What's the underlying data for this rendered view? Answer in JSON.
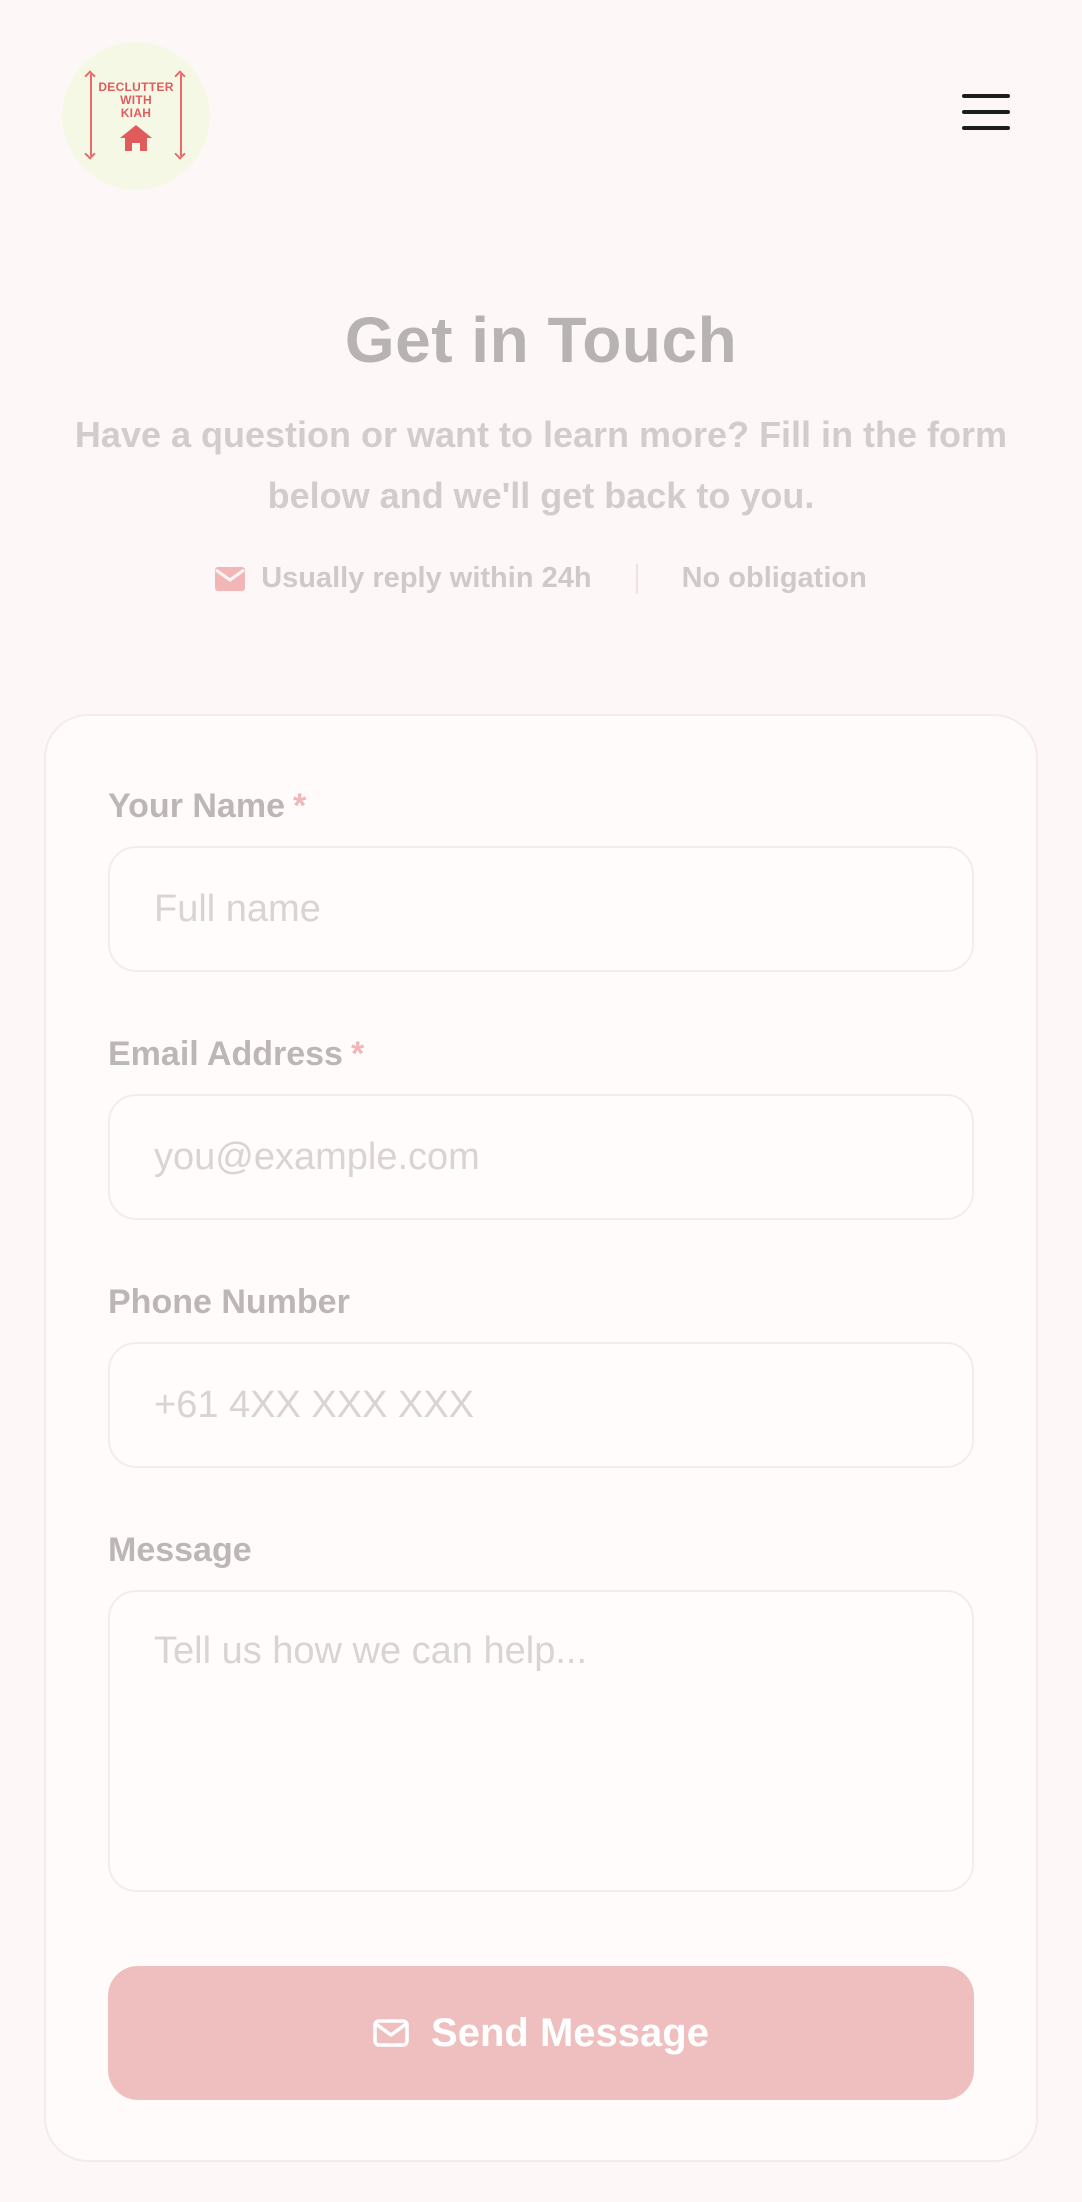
{
  "header": {
    "logo_text": "Declutter with Kiah",
    "logo_lines": [
      "DECLUTTER",
      "WITH",
      "KIAH"
    ],
    "menu_icon": "hamburger-icon"
  },
  "hero": {
    "title": "Get in Touch",
    "subtitle": "Have a question or want to learn more? Fill in the form below and we'll get back to you.",
    "badges": {
      "reply": "Usually reply within 24h",
      "reply_icon": "envelope-icon",
      "obligation": "No obligation"
    }
  },
  "form": {
    "name": {
      "label": "Your Name",
      "required_mark": "*",
      "placeholder": "Full name"
    },
    "email": {
      "label": "Email Address",
      "required_mark": "*",
      "placeholder": "you@example.com"
    },
    "phone": {
      "label": "Phone Number",
      "placeholder": "+61 4XX XXX XXX"
    },
    "message": {
      "label": "Message",
      "placeholder": "Tell us how we can help..."
    },
    "submit": {
      "label": "Send Message",
      "icon": "mail-icon"
    }
  },
  "colors": {
    "brand": "#e05c5c",
    "button": "#efbfbf",
    "background": "#fdf8f7",
    "required": "#f3b6b6"
  }
}
